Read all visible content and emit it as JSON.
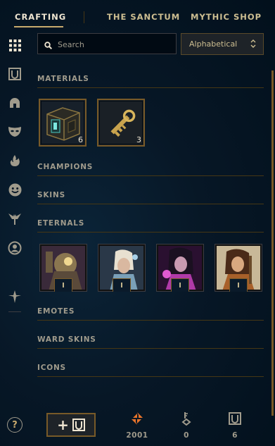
{
  "nav": {
    "tabs": [
      {
        "label": "CRAFTING",
        "active": true
      },
      {
        "label": "THE SANCTUM",
        "active": false
      },
      {
        "label": "MYTHIC SHOP",
        "active": false
      }
    ]
  },
  "sidebar": {
    "items": [
      {
        "icon": "grid-icon",
        "active": true
      },
      {
        "icon": "chest-icon"
      },
      {
        "icon": "helmet-icon"
      },
      {
        "icon": "mask-icon"
      },
      {
        "icon": "flame-icon"
      },
      {
        "icon": "emote-face-icon"
      },
      {
        "icon": "ward-icon"
      },
      {
        "icon": "profile-icon"
      },
      {
        "icon": "reroll-icon"
      }
    ]
  },
  "toolbar": {
    "search_placeholder": "Search",
    "sort_value": "Alphabetical"
  },
  "sections": {
    "materials": {
      "title": "MATERIALS",
      "items": [
        {
          "name": "hextech-chest",
          "count": "6"
        },
        {
          "name": "hextech-key",
          "count": "3"
        }
      ]
    },
    "champions": {
      "title": "CHAMPIONS"
    },
    "skins": {
      "title": "SKINS"
    },
    "eternals": {
      "title": "ETERNALS",
      "badge": "I"
    },
    "emotes": {
      "title": "EMOTES"
    },
    "ward_skins": {
      "title": "WARD SKINS"
    },
    "icons": {
      "title": "ICONS"
    }
  },
  "footer": {
    "help_label": "?",
    "add_label": "+",
    "currencies": [
      {
        "icon": "orange-essence-icon",
        "value": "2001"
      },
      {
        "icon": "key-fragment-icon",
        "value": "0"
      },
      {
        "icon": "chest-icon",
        "value": "6"
      }
    ]
  },
  "colors": {
    "gold": "#c8aa6e",
    "gold_dark": "#785a28",
    "text_muted": "#a09b8c",
    "background": "#010a13",
    "orange_essence": "#e8742b"
  }
}
